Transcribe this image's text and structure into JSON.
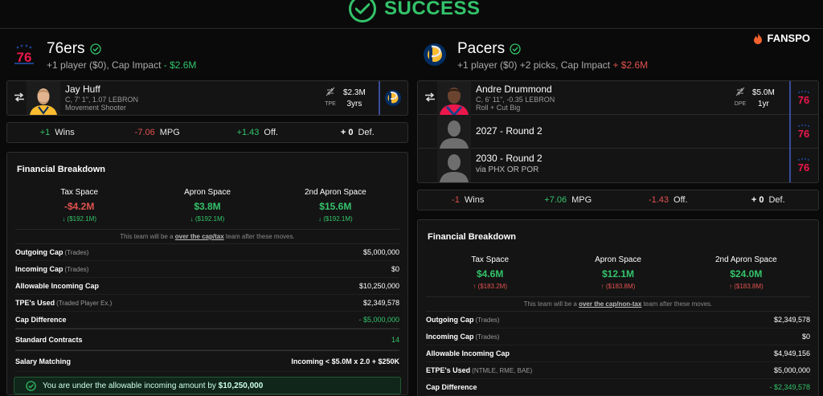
{
  "status": {
    "label": "SUCCESS"
  },
  "brand": {
    "name": "FANSPO"
  },
  "left": {
    "team": "76ers",
    "summary_prefix": "+1 player ($0), Cap Impact ",
    "summary_impact": "- $2.6M",
    "players": [
      {
        "name": "Jay Huff",
        "meta1": "C, 7' 1\", 1.07 LEBRON",
        "meta2": "Movement Shooter",
        "exception": "TPE",
        "salary": "$2.3M",
        "years": "3yrs"
      }
    ],
    "stats": [
      {
        "value": "+1",
        "label": "Wins",
        "tone": "pos"
      },
      {
        "value": "-7.06",
        "label": "MPG",
        "tone": "neg"
      },
      {
        "value": "+1.43",
        "label": "Off.",
        "tone": "pos"
      },
      {
        "value": "+ 0",
        "label": "Def.",
        "tone": "neu"
      }
    ],
    "financial": {
      "title": "Financial Breakdown",
      "spaces": [
        {
          "label": "Tax Space",
          "value": "-$4.2M",
          "tone": "neg",
          "sub": "($192.1M)",
          "arrow": "down"
        },
        {
          "label": "Apron Space",
          "value": "$3.8M",
          "tone": "pos",
          "sub": "($192.1M)",
          "arrow": "down"
        },
        {
          "label": "2nd Apron Space",
          "value": "$15.6M",
          "tone": "pos",
          "sub": "($192.1M)",
          "arrow": "down"
        }
      ],
      "note_prefix": "This team will be a ",
      "note_bold": "over the cap/tax",
      "note_suffix": " team after these moves.",
      "rows": [
        {
          "label": "Outgoing Cap",
          "hint": "(Trades)",
          "value": "$5,000,000",
          "tone": ""
        },
        {
          "label": "Incoming Cap",
          "hint": "(Trades)",
          "value": "$0",
          "tone": ""
        },
        {
          "label": "Allowable Incoming Cap",
          "hint": "",
          "value": "$10,250,000",
          "tone": ""
        },
        {
          "label": "TPE's Used",
          "hint": "(Traded Player Ex.)",
          "value": "$2,349,578",
          "tone": ""
        },
        {
          "label": "Cap Difference",
          "hint": "",
          "value": "- $5,000,000",
          "tone": "pos"
        }
      ],
      "contracts": {
        "label": "Standard Contracts",
        "value": "14"
      },
      "matching": {
        "label": "Salary Matching",
        "value": "Incoming < $5.0M x 2.0 + $250K"
      },
      "ok_prefix": "You are under the allowable incoming amount by ",
      "ok_amount": "$10,250,000"
    }
  },
  "right": {
    "team": "Pacers",
    "summary_prefix": "+1 player ($0) +2 picks, Cap Impact ",
    "summary_impact": "+ $2.6M",
    "players": [
      {
        "name": "Andre Drummond",
        "meta1": "C, 6' 11\", -0.35 LEBRON",
        "meta2": "Roll + Cut Big",
        "exception": "DPE",
        "salary": "$5.0M",
        "years": "1yr"
      }
    ],
    "picks": [
      {
        "name": "2027 - Round 2",
        "detail": ""
      },
      {
        "name": "2030 - Round 2",
        "detail": "via PHX OR POR"
      }
    ],
    "stats": [
      {
        "value": "-1",
        "label": "Wins",
        "tone": "neg"
      },
      {
        "value": "+7.06",
        "label": "MPG",
        "tone": "pos"
      },
      {
        "value": "-1.43",
        "label": "Off.",
        "tone": "neg"
      },
      {
        "value": "+ 0",
        "label": "Def.",
        "tone": "neu"
      }
    ],
    "financial": {
      "title": "Financial Breakdown",
      "spaces": [
        {
          "label": "Tax Space",
          "value": "$4.6M",
          "tone": "pos",
          "sub": "($183.2M)",
          "arrow": "up"
        },
        {
          "label": "Apron Space",
          "value": "$12.1M",
          "tone": "pos",
          "sub": "($183.8M)",
          "arrow": "up"
        },
        {
          "label": "2nd Apron Space",
          "value": "$24.0M",
          "tone": "pos",
          "sub": "($183.8M)",
          "arrow": "up"
        }
      ],
      "note_prefix": "This team will be a ",
      "note_bold": "over the cap/non-tax",
      "note_suffix": " team after these moves.",
      "rows": [
        {
          "label": "Outgoing Cap",
          "hint": "(Trades)",
          "value": "$2,349,578",
          "tone": ""
        },
        {
          "label": "Incoming Cap",
          "hint": "(Trades)",
          "value": "$0",
          "tone": ""
        },
        {
          "label": "Allowable Incoming Cap",
          "hint": "",
          "value": "$4,949,156",
          "tone": ""
        },
        {
          "label": "ETPE's Used",
          "hint": "(NTMLE, RME, BAE)",
          "value": "$5,000,000",
          "tone": ""
        },
        {
          "label": "Cap Difference",
          "hint": "",
          "value": "- $2,349,578",
          "tone": "pos"
        }
      ]
    }
  },
  "colors": {
    "success": "#33c36a",
    "negative": "#e0524f",
    "sixers_blue": "#1d428a",
    "sixers_red": "#ed174c",
    "pacers_navy": "#002d62",
    "pacers_gold": "#fdbb30"
  }
}
